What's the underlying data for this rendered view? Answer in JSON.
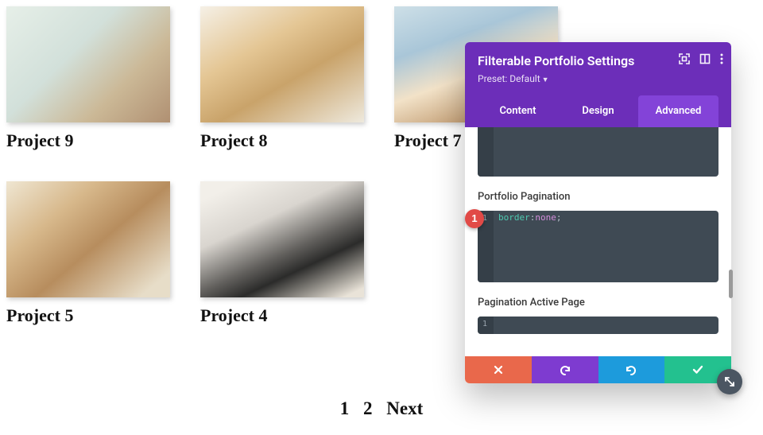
{
  "projects": [
    {
      "title": "Project 9"
    },
    {
      "title": "Project 8"
    },
    {
      "title": "Project 7"
    },
    {
      "title": "Project 5"
    },
    {
      "title": "Project 4"
    }
  ],
  "pagination": {
    "p1": "1",
    "p2": "2",
    "next": "Next"
  },
  "panel": {
    "title": "Filterable Portfolio Settings",
    "preset_label": "Preset: Default",
    "tabs": {
      "content": "Content",
      "design": "Design",
      "advanced": "Advanced"
    },
    "sections": {
      "portfolio_pagination": "Portfolio Pagination",
      "pagination_active_page": "Pagination Active Page"
    },
    "code": {
      "pagination_prop": "border",
      "pagination_punc1": ":",
      "pagination_val": "none",
      "pagination_punc2": ";",
      "line1": "1"
    },
    "marker": "1"
  }
}
